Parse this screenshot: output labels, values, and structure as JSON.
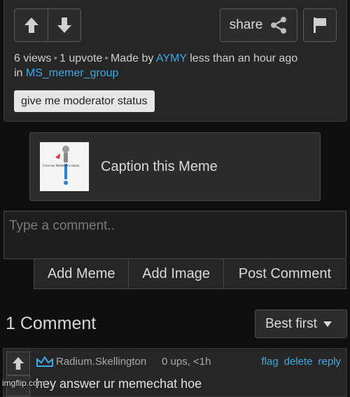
{
  "post": {
    "share_label": "share",
    "views": "6 views",
    "upvotes": "1 upvote",
    "made_by_prefix": "Made by",
    "author": "AYMY",
    "time": "less than an hour ago",
    "in_prefix": "in",
    "group": "MS_memer_group",
    "tag": "give me moderator status"
  },
  "caption": {
    "label": "Caption this Meme",
    "thumb_text": "Give me Moderator status"
  },
  "comment_form": {
    "placeholder": "Type a comment..",
    "add_meme": "Add Meme",
    "add_image": "Add Image",
    "post_comment": "Post Comment"
  },
  "comments_header": {
    "title": "1 Comment",
    "sort_value": "Best first"
  },
  "comment": {
    "user": "Radium.Skellington",
    "meta": "0 ups, <1h",
    "flag": "flag",
    "delete": "delete",
    "reply": "reply",
    "text": "hey answer ur memechat hoe"
  },
  "watermark": "imgflip.com",
  "colors": {
    "link": "#3fa9e6",
    "crown": "#3fa9e6",
    "background": "#0f0f0f",
    "panel": "#262626"
  }
}
